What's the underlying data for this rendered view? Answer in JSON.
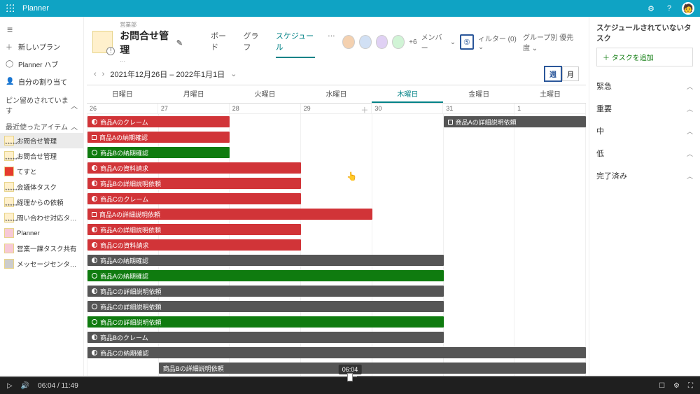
{
  "app_name": "Planner",
  "topbar": {
    "gear": "⚙",
    "help": "?"
  },
  "leftnav": {
    "new_plan": "新しいプラン",
    "hub": "Planner ハブ",
    "assigned": "自分の割り当て",
    "pinned_header": "ピン留めされています",
    "recent_header": "最近使ったアイテム",
    "recent": [
      {
        "label": "お問合せ管理",
        "cls": "org",
        "active": true
      },
      {
        "label": "お問合せ管理",
        "cls": "org"
      },
      {
        "label": "てすと",
        "cls": "red"
      },
      {
        "label": "会議体タスク",
        "cls": "org"
      },
      {
        "label": "経理からの依頼",
        "cls": "org"
      },
      {
        "label": "問い合わせ対応タスク",
        "cls": "org"
      },
      {
        "label": "Planner",
        "cls": "pink"
      },
      {
        "label": "営業一課タスク共有",
        "cls": "pink"
      },
      {
        "label": "メッセージセンター情...",
        "cls": "gray"
      }
    ]
  },
  "plan": {
    "subtitle": "営業部",
    "title": "お問合せ管理",
    "dots": "…",
    "tabs": {
      "board": "ボード",
      "chart": "グラフ",
      "schedule": "スケジュール",
      "more": "…"
    },
    "members_extra": "+6",
    "member_label": "メンバー",
    "callout": "⑤",
    "filter": "ィルター (0)",
    "group": "グループ別 優先度"
  },
  "dates": {
    "range": "2021年12月26日 – 2022年1月1日",
    "week": "週",
    "month": "月",
    "days": [
      "日曜日",
      "月曜日",
      "火曜日",
      "水曜日",
      "木曜日",
      "金曜日",
      "土曜日"
    ],
    "nums": [
      "26",
      "27",
      "28",
      "29",
      "30",
      "31",
      "1"
    ]
  },
  "tasks": [
    {
      "label": "商品Aのクレーム",
      "cls": "red",
      "row": 0,
      "start": 0,
      "span": 2,
      "icon": "half"
    },
    {
      "label": "商品Aの納期確認",
      "cls": "red",
      "row": 1,
      "start": 0,
      "span": 2,
      "icon": "sq"
    },
    {
      "label": "商品Bの納期確認",
      "cls": "green",
      "row": 2,
      "start": 0,
      "span": 2,
      "icon": "dot"
    },
    {
      "label": "商品Aの資料請求",
      "cls": "red",
      "row": 3,
      "start": 0,
      "span": 3,
      "icon": "half"
    },
    {
      "label": "商品Bの詳細説明依頼",
      "cls": "red",
      "row": 4,
      "start": 0,
      "span": 3,
      "icon": "half"
    },
    {
      "label": "商品Cのクレーム",
      "cls": "red",
      "row": 5,
      "start": 0,
      "span": 3,
      "icon": "half"
    },
    {
      "label": "商品Aの詳細説明依頼",
      "cls": "red",
      "row": 6,
      "start": 0,
      "span": 4,
      "icon": "sq"
    },
    {
      "label": "商品Aの詳細説明依頼",
      "cls": "red",
      "row": 7,
      "start": 0,
      "span": 3,
      "icon": "half"
    },
    {
      "label": "商品Cの資料請求",
      "cls": "red",
      "row": 8,
      "start": 0,
      "span": 3,
      "icon": "half"
    },
    {
      "label": "商品Aの納期確認",
      "cls": "dark",
      "row": 9,
      "start": 0,
      "span": 5,
      "icon": "half"
    },
    {
      "label": "商品Aの納期確認",
      "cls": "green",
      "row": 10,
      "start": 0,
      "span": 5,
      "icon": "dot"
    },
    {
      "label": "商品Cの詳細説明依頼",
      "cls": "dark",
      "row": 11,
      "start": 0,
      "span": 5,
      "icon": "half"
    },
    {
      "label": "商品Cの詳細説明依頼",
      "cls": "dark",
      "row": 12,
      "start": 0,
      "span": 5,
      "icon": "dot"
    },
    {
      "label": "商品Cの詳細説明依頼",
      "cls": "green",
      "row": 13,
      "start": 0,
      "span": 5,
      "icon": "dot"
    },
    {
      "label": "商品Bのクレーム",
      "cls": "dark",
      "row": 14,
      "start": 0,
      "span": 5,
      "icon": "half"
    },
    {
      "label": "商品Cの納期確認",
      "cls": "dark",
      "row": 15,
      "start": 0,
      "span": 7,
      "icon": "half"
    },
    {
      "label": "商品Bの詳細説明依頼",
      "cls": "dark",
      "row": 16,
      "start": 1,
      "span": 6,
      "icon": ""
    },
    {
      "label": "商品Aの詳細説明依頼",
      "cls": "dark",
      "row": 0,
      "start": 5,
      "span": 2,
      "icon": "sq"
    }
  ],
  "right": {
    "header": "スケジュールされていないタスク",
    "add": "＋ タスクを追加",
    "buckets": [
      "緊急",
      "重要",
      "中",
      "低",
      "完了済み"
    ]
  },
  "video": {
    "time": "06:04 / 11:49",
    "tooltip": "06:04"
  }
}
